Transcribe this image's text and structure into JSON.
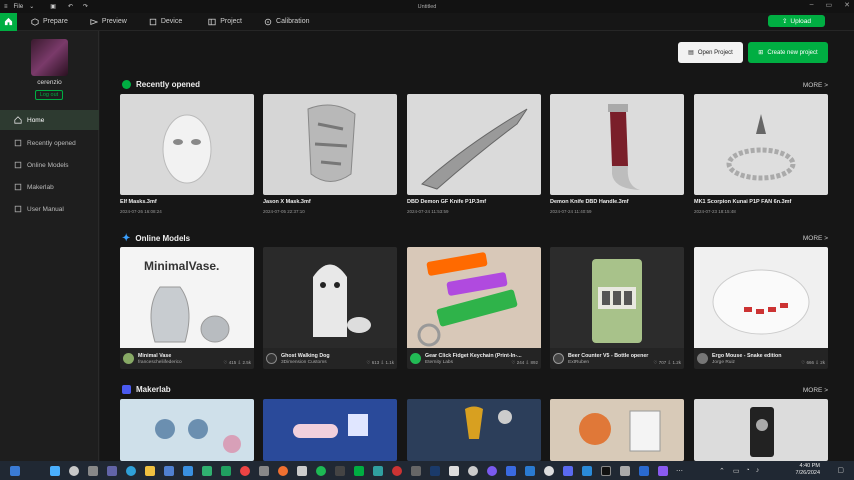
{
  "window": {
    "title": "Untitled",
    "file_menu": "File"
  },
  "nav": {
    "tabs": [
      "Prepare",
      "Preview",
      "Device",
      "Project",
      "Calibration"
    ],
    "upload_label": "Upload"
  },
  "user": {
    "name": "cerenzio",
    "logout_label": "Log out"
  },
  "sidebar": {
    "items": [
      {
        "label": "Home",
        "icon": "home-icon",
        "active": true
      },
      {
        "label": "Recently opened",
        "icon": "clock-icon",
        "active": false
      },
      {
        "label": "Online Models",
        "icon": "globe-icon",
        "active": false
      },
      {
        "label": "Makerlab",
        "icon": "makerlab-icon",
        "active": false
      },
      {
        "label": "User Manual",
        "icon": "book-icon",
        "active": false
      }
    ]
  },
  "actions": {
    "open_project": "Open Project",
    "create_project": "Create new project"
  },
  "recent": {
    "title": "Recently opened",
    "more": "MORE >",
    "items": [
      {
        "name": "Elf Masks.3mf",
        "date": "2024-07-26 16:08:24"
      },
      {
        "name": "Jason X Mask.3mf",
        "date": "2024-07-05 22:37:10"
      },
      {
        "name": "DBD Demon GF Knife P1P.3mf",
        "date": "2024-07-24 11:53:59"
      },
      {
        "name": "Demon Knife DBD Handle.3mf",
        "date": "2024-07-24 11:40:59"
      },
      {
        "name": "MK1 Scorpion Kunai P1P FAN 6n.3mf",
        "date": "2024-07-23 18:15:48"
      }
    ]
  },
  "online": {
    "title": "Online Models",
    "more": "MORE >",
    "items": [
      {
        "title": "Minimal Vase",
        "author": "francescheliifederico",
        "likes": "415",
        "downloads": "2.5k",
        "banner": "MinimalVase."
      },
      {
        "title": "Ghost Walking Dog",
        "author": "3Dimension Customs",
        "likes": "613",
        "downloads": "1.1k"
      },
      {
        "title": "Gear Click Fidget Keychain (Print-In-...",
        "author": "Eternity Labs",
        "likes": "244",
        "downloads": "892"
      },
      {
        "title": "Beer Counter V5 - Bottle opener",
        "author": "ExtRuben",
        "likes": "707",
        "downloads": "1.2k"
      },
      {
        "title": "Ergo Mouse - Snake edition",
        "author": "Jorge Ruiz",
        "likes": "666",
        "downloads": "2k"
      }
    ]
  },
  "makerlab": {
    "title": "Makerlab",
    "more": "MORE >"
  },
  "clock": {
    "time": "4:40 PM",
    "date": "7/26/2024"
  },
  "colors": {
    "accent": "#00ae42",
    "bg": "#161616",
    "sidebar": "#1e1e1e"
  }
}
